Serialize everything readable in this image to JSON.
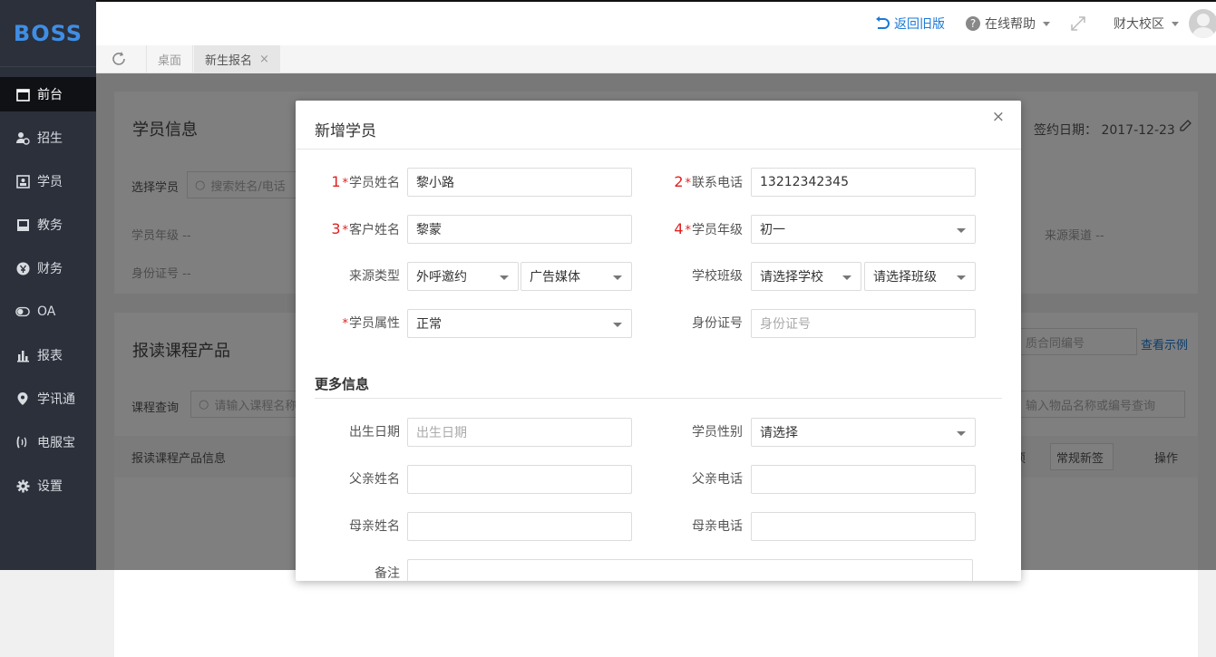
{
  "sidebar": {
    "logo": "BOSS",
    "items": [
      {
        "label": "前台",
        "icon": "calendar-icon"
      },
      {
        "label": "招生",
        "icon": "person-add-icon"
      },
      {
        "label": "学员",
        "icon": "id-card-icon"
      },
      {
        "label": "教务",
        "icon": "book-icon"
      },
      {
        "label": "财务",
        "icon": "yen-icon"
      },
      {
        "label": "OA",
        "icon": "toggle-icon"
      },
      {
        "label": "报表",
        "icon": "bar-chart-icon"
      },
      {
        "label": "学讯通",
        "icon": "location-pin-icon"
      },
      {
        "label": "电服宝",
        "icon": "headset-icon"
      },
      {
        "label": "设置",
        "icon": "gear-icon"
      }
    ]
  },
  "topbar": {
    "back_label": "返回旧版",
    "help_label": "在线帮助",
    "campus_label": "财大校区"
  },
  "tabs": [
    {
      "label": "桌面"
    },
    {
      "label": "新生报名",
      "close": "×"
    }
  ],
  "background": {
    "student_info_title": "学员信息",
    "sign_date_label": "签约日期：",
    "sign_date_value": "2017-12-23",
    "select_student_label": "选择学员",
    "select_student_placeholder": "搜索姓名/电话",
    "grade_label": "学员年级 --",
    "id_label": "身份证号 --",
    "source_label": "来源渠道 --",
    "course_title": "报读课程产品",
    "contract_placeholder": "质合同编号",
    "view_example": "查看示例",
    "course_query_label": "课程查询",
    "course_query_placeholder": "请输入课程名称",
    "item_query_placeholder": "输入物品名称或编号查询",
    "table_header": "报读课程产品信息",
    "col_partial": "项",
    "col_select": "常规新签",
    "col_action": "操作"
  },
  "modal": {
    "title": "新增学员",
    "close": "×",
    "fields": {
      "student_name": {
        "num": "1",
        "label": "学员姓名",
        "value": "黎小路"
      },
      "phone": {
        "num": "2",
        "label": "联系电话",
        "value": "13212342345"
      },
      "customer_name": {
        "num": "3",
        "label": "客户姓名",
        "value": "黎蒙"
      },
      "grade": {
        "num": "4",
        "label": "学员年级",
        "value": "初一"
      },
      "source_type": {
        "label": "来源类型",
        "value1": "外呼邀约",
        "value2": "广告媒体"
      },
      "school_class": {
        "label": "学校班级",
        "value1": "请选择学校",
        "value2": "请选择班级"
      },
      "attribute": {
        "label": "学员属性",
        "value": "正常"
      },
      "id_number": {
        "label": "身份证号",
        "placeholder": "身份证号"
      }
    },
    "more_title": "更多信息",
    "more": {
      "birth": {
        "label": "出生日期",
        "placeholder": "出生日期"
      },
      "gender": {
        "label": "学员性别",
        "value": "请选择"
      },
      "father_name": {
        "label": "父亲姓名"
      },
      "father_phone": {
        "label": "父亲电话"
      },
      "mother_name": {
        "label": "母亲姓名"
      },
      "mother_phone": {
        "label": "母亲电话"
      },
      "remark": {
        "label": "备注"
      }
    },
    "required_mark": "*"
  }
}
